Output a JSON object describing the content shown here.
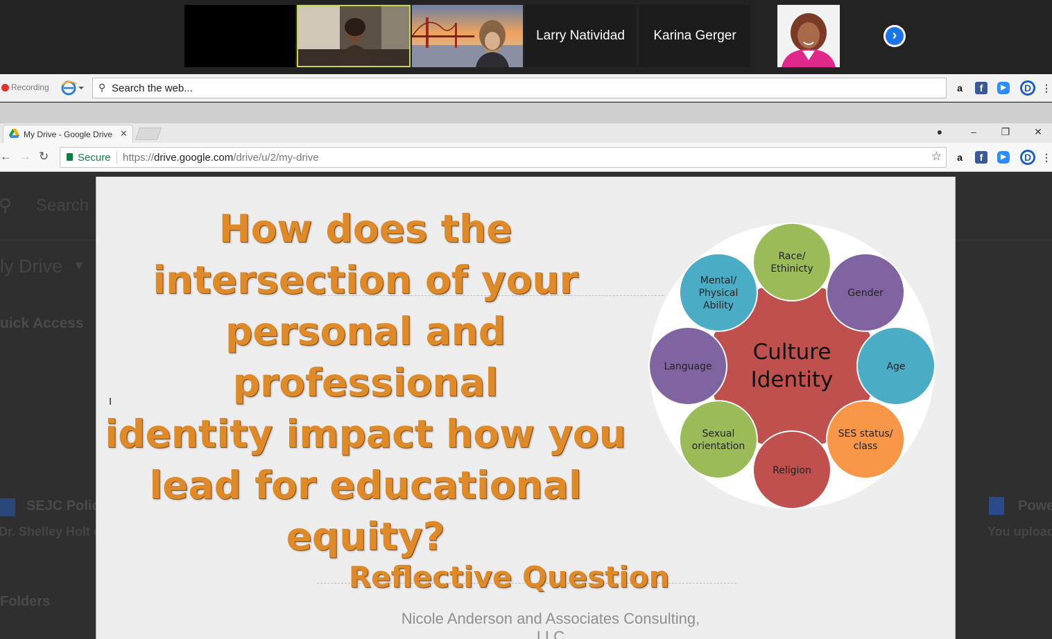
{
  "zoom": {
    "participants": [
      {
        "name": "",
        "kind": "video-off"
      },
      {
        "name": "",
        "kind": "video",
        "active": true
      },
      {
        "name": "",
        "kind": "video-bridge"
      },
      {
        "name": "Larry Natividad",
        "kind": "name-only"
      },
      {
        "name": "Karina Gerger",
        "kind": "name-only"
      },
      {
        "name": "",
        "kind": "photo"
      }
    ],
    "next_icon": "chevron-right-icon"
  },
  "toolbar": {
    "recording_label": "Recording",
    "search_placeholder": "Search the web...",
    "extensions": [
      "amazon-icon",
      "facebook-icon",
      "zoom-icon",
      "dashlane-icon",
      "more-icon"
    ]
  },
  "browser": {
    "tab_title": "My Drive - Google Drive",
    "secure_label": "Secure",
    "url_scheme": "https://",
    "url_host": "drive.google.com",
    "url_path": "/drive/u/2/my-drive"
  },
  "drive_background": {
    "search_label": "Search",
    "title": "ly Drive",
    "quick_access": "uick Access",
    "file_left_name": "SEJC Polic",
    "file_left_owner": "Dr. Shelley Holt e",
    "file_right_name": "Powe",
    "file_right_owner": "You upload",
    "folders": "Folders"
  },
  "slide": {
    "question_lines": [
      "How does the",
      "intersection of  your",
      "personal and professional",
      "identity impact how you",
      "lead for educational",
      "equity?"
    ],
    "heading": "Reflective Question",
    "credit": "Nicole Anderson and Associates Consulting, LLC",
    "diagram": {
      "center_lines": [
        "Culture",
        "Identity"
      ],
      "center_color": "#c0504d",
      "petals": [
        {
          "lines": [
            "Race/",
            "Ethinicty"
          ],
          "color": "#9bbb59"
        },
        {
          "lines": [
            "Gender"
          ],
          "color": "#8064a2"
        },
        {
          "lines": [
            "Age"
          ],
          "color": "#4bacc6"
        },
        {
          "lines": [
            "SES status/",
            "class"
          ],
          "color": "#f79646"
        },
        {
          "lines": [
            "Religion"
          ],
          "color": "#c0504d"
        },
        {
          "lines": [
            "Sexual",
            "orientation"
          ],
          "color": "#9bbb59"
        },
        {
          "lines": [
            "Language"
          ],
          "color": "#8064a2"
        },
        {
          "lines": [
            "Mental/",
            "Physical",
            "Ability"
          ],
          "color": "#4bacc6"
        }
      ]
    }
  }
}
